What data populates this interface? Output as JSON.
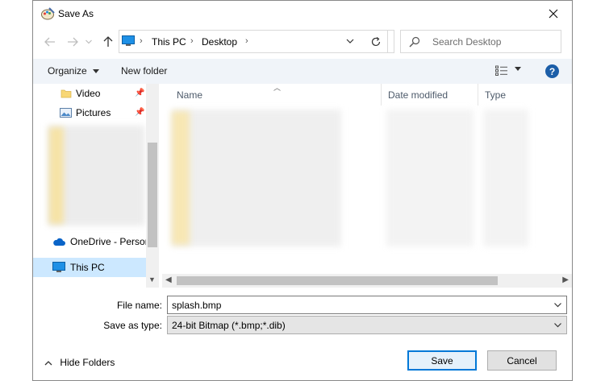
{
  "window": {
    "title": "Save As"
  },
  "address": {
    "crumbs": [
      "This PC",
      "Desktop"
    ]
  },
  "search": {
    "placeholder": "Search Desktop"
  },
  "toolbar": {
    "organize": "Organize",
    "new_folder": "New folder",
    "help": "?"
  },
  "nav": {
    "items": [
      {
        "label": "Video",
        "pinned": true
      },
      {
        "label": "Pictures",
        "pinned": true
      },
      {
        "label": "OneDrive - Person"
      },
      {
        "label": "This PC",
        "selected": true
      }
    ]
  },
  "columns": [
    "Name",
    "Date modified",
    "Type"
  ],
  "fields": {
    "file_name_label": "File name:",
    "file_name_value": "splash.bmp",
    "save_type_label": "Save as type:",
    "save_type_value": "24-bit Bitmap (*.bmp;*.dib)"
  },
  "footer": {
    "hide_folders": "Hide Folders",
    "save": "Save",
    "cancel": "Cancel"
  },
  "colors": {
    "accent": "#0078d7",
    "selected": "#cce8ff",
    "toolbar": "#f0f4f9"
  }
}
